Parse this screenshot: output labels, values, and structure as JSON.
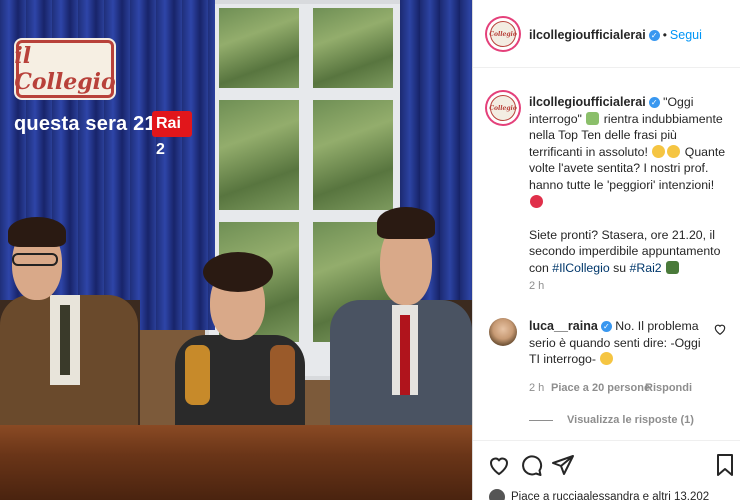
{
  "post": {
    "logo_text": "il Collegio",
    "tagline": "questa sera 21.20",
    "channel": "Rai 2"
  },
  "header": {
    "username": "ilcollegioufficialerai",
    "follow_label": "Segui"
  },
  "caption": {
    "username": "ilcollegioufficialerai",
    "part1": "\"Oggi interrogo\"",
    "part2": "rientra indubbiamente nella Top Ten delle frasi più terrificanti in assoluto!",
    "part3": "Quante volte l'avete sentita? I nostri prof. hanno tutte le 'peggiori' intenzioni!",
    "part4": "Siete pronti? Stasera, ore 21.20, il secondo imperdibile appuntamento con",
    "hashtag1": "#IlCollegio",
    "part5": "su",
    "hashtag2": "#Rai2",
    "time": "2 h"
  },
  "comment": {
    "username": "luca__raina",
    "text": "No. Il problema serio è quando senti dire: -Oggi TI interrogo-",
    "time": "2 h",
    "likes": "Piace a 20 persone",
    "reply_label": "Rispondi",
    "view_replies": "Visualizza le risposte (1)"
  },
  "footer": {
    "likes_text": "Piace a rucciaalessandra e altri 13.202"
  },
  "icons": [
    "heart-icon",
    "comment-icon",
    "share-icon",
    "bookmark-icon",
    "verified-icon",
    "more-icon"
  ],
  "colors": {
    "accent": "#0095f6",
    "brand_red": "#b8413a",
    "rai_red": "#e1161b",
    "story_ring": "#e4407a"
  }
}
